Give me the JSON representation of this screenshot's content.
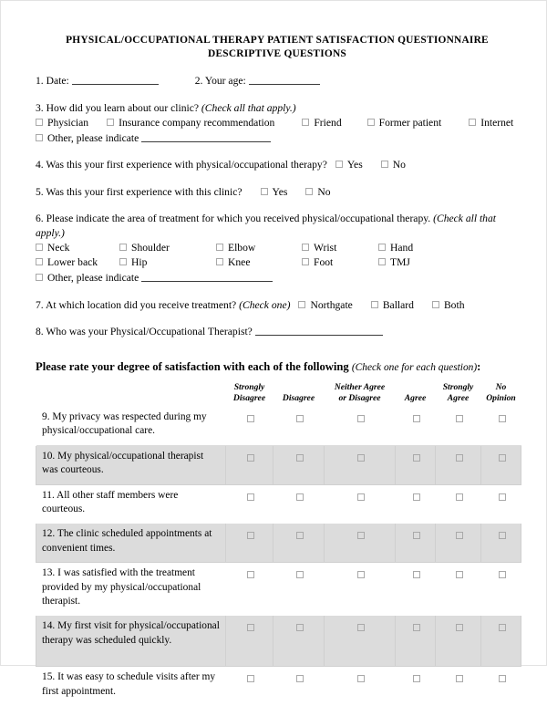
{
  "document": {
    "title_line1": "PHYSICAL/OCCUPATIONAL THERAPY PATIENT SATISFACTION QUESTIONNAIRE",
    "title_line2": "DESCRIPTIVE QUESTIONS"
  },
  "questions": {
    "q1_label": "1. Date:",
    "q2_label": "2. Your age:",
    "q3_label": "3. How did you learn about our clinic?",
    "q3_instruction": "(Check all that apply.)",
    "q3_options": [
      "Physician",
      "Insurance company recommendation",
      "Friend",
      "Former patient",
      "Internet"
    ],
    "q3_other": "Other, please indicate",
    "q4_label": "4. Was this your first experience with physical/occupational therapy?",
    "q4_yes": "Yes",
    "q4_no": "No",
    "q5_label": "5. Was this your first experience with this clinic?",
    "q5_yes": "Yes",
    "q5_no": "No",
    "q6_label": "6. Please indicate the area of treatment for which you received physical/occupational therapy.",
    "q6_instruction": "(Check all that apply.)",
    "q6_options": [
      "Neck",
      "Shoulder",
      "Elbow",
      "Wrist",
      "Hand",
      "Lower back",
      "Hip",
      "Knee",
      "Foot",
      "TMJ"
    ],
    "q6_other": "Other, please indicate",
    "q7_label": "7. At which location did you receive treatment?",
    "q7_instruction": "(Check one)",
    "q7_options": [
      "Northgate",
      "Ballard",
      "Both"
    ],
    "q8_label": "8. Who was your Physical/Occupational Therapist?"
  },
  "rating_section": {
    "heading": "Please rate your degree of satisfaction with each of the following",
    "heading_instruction": "(Check one for each question)",
    "heading_suffix": ":",
    "columns": [
      "Strongly Disagree",
      "Disagree",
      "Neither Agree or Disagree",
      "Agree",
      "Strongly Agree",
      "No Opinion"
    ],
    "columns_split": [
      {
        "top": "Strongly",
        "bottom": "Disagree"
      },
      {
        "top": "",
        "bottom": "Disagree"
      },
      {
        "top": "Neither Agree",
        "bottom": "or Disagree"
      },
      {
        "top": "",
        "bottom": "Agree"
      },
      {
        "top": "Strongly",
        "bottom": "Agree"
      },
      {
        "top": "No",
        "bottom": "Opinion"
      }
    ],
    "rows": [
      {
        "text": "9.  My privacy was respected during my physical/occupational care.",
        "shaded": false,
        "tall": false
      },
      {
        "text": "10.  My physical/occupational therapist was courteous.",
        "shaded": true,
        "tall": false
      },
      {
        "text": "11.  All other staff members were courteous.",
        "shaded": false,
        "tall": false
      },
      {
        "text": "12.  The clinic scheduled appointments at convenient times.",
        "shaded": true,
        "tall": false
      },
      {
        "text": "13.  I was satisfied with the treatment provided by my physical/occupational therapist.",
        "shaded": false,
        "tall": false
      },
      {
        "text": "14.  My first visit for physical/occupational therapy was scheduled quickly.",
        "shaded": true,
        "tall": true
      },
      {
        "text": "15.  It was easy to schedule visits after my first appointment.",
        "shaded": false,
        "tall": false
      }
    ]
  }
}
